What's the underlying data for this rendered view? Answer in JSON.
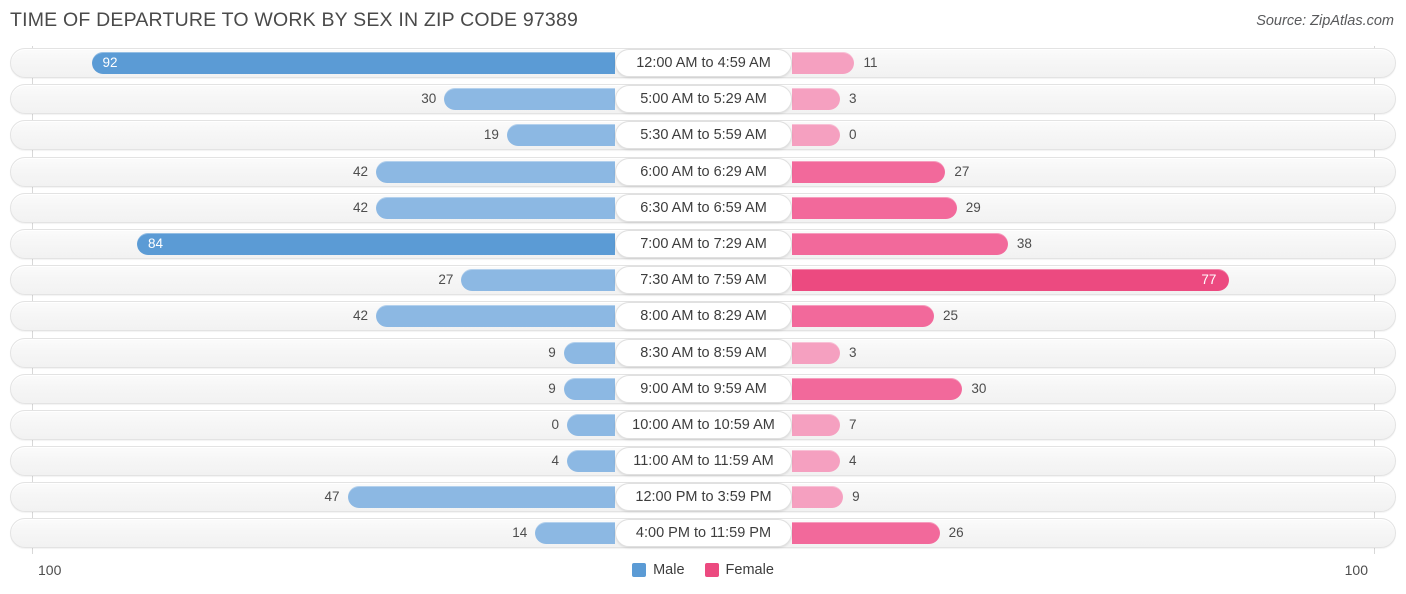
{
  "header": {
    "title": "TIME OF DEPARTURE TO WORK BY SEX IN ZIP CODE 97389",
    "source": "Source: ZipAtlas.com"
  },
  "legend": {
    "items": [
      {
        "label": "Male",
        "color": "#5b9bd5"
      },
      {
        "label": "Female",
        "color": "#ec4a80"
      }
    ]
  },
  "axis": {
    "left_max_label": "100",
    "right_max_label": "100"
  },
  "colors": {
    "male_strong": "#5b9bd5",
    "male_light": "#8cb8e3",
    "female_strong": "#ec4a80",
    "female_mid": "#f2699b",
    "female_light": "#f5a0c0",
    "track": "#f4f4f4",
    "axis_line": "#d8d8d8"
  },
  "chart_data": {
    "type": "bar",
    "title": "TIME OF DEPARTURE TO WORK BY SEX IN ZIP CODE 97389",
    "orientation": "horizontal-diverging",
    "xlabel": "",
    "ylabel": "",
    "xlim": [
      0,
      100
    ],
    "grid": false,
    "legend_position": "bottom-center",
    "categories": [
      "12:00 AM to 4:59 AM",
      "5:00 AM to 5:29 AM",
      "5:30 AM to 5:59 AM",
      "6:00 AM to 6:29 AM",
      "6:30 AM to 6:59 AM",
      "7:00 AM to 7:29 AM",
      "7:30 AM to 7:59 AM",
      "8:00 AM to 8:29 AM",
      "8:30 AM to 8:59 AM",
      "9:00 AM to 9:59 AM",
      "10:00 AM to 10:59 AM",
      "11:00 AM to 11:59 AM",
      "12:00 PM to 3:59 PM",
      "4:00 PM to 11:59 PM"
    ],
    "series": [
      {
        "name": "Male",
        "values": [
          92,
          30,
          19,
          42,
          42,
          84,
          27,
          42,
          9,
          9,
          0,
          4,
          47,
          14
        ]
      },
      {
        "name": "Female",
        "values": [
          11,
          3,
          0,
          27,
          29,
          38,
          77,
          25,
          3,
          30,
          7,
          4,
          9,
          26
        ]
      }
    ]
  },
  "rows": [
    {
      "category": "12:00 AM to 4:59 AM",
      "male": "92",
      "female": "11"
    },
    {
      "category": "5:00 AM to 5:29 AM",
      "male": "30",
      "female": "3"
    },
    {
      "category": "5:30 AM to 5:59 AM",
      "male": "19",
      "female": "0"
    },
    {
      "category": "6:00 AM to 6:29 AM",
      "male": "42",
      "female": "27"
    },
    {
      "category": "6:30 AM to 6:59 AM",
      "male": "42",
      "female": "29"
    },
    {
      "category": "7:00 AM to 7:29 AM",
      "male": "84",
      "female": "38"
    },
    {
      "category": "7:30 AM to 7:59 AM",
      "male": "27",
      "female": "77"
    },
    {
      "category": "8:00 AM to 8:29 AM",
      "male": "42",
      "female": "25"
    },
    {
      "category": "8:30 AM to 8:59 AM",
      "male": "9",
      "female": "3"
    },
    {
      "category": "9:00 AM to 9:59 AM",
      "male": "9",
      "female": "30"
    },
    {
      "category": "10:00 AM to 10:59 AM",
      "male": "0",
      "female": "7"
    },
    {
      "category": "11:00 AM to 11:59 AM",
      "male": "4",
      "female": "4"
    },
    {
      "category": "12:00 PM to 3:59 PM",
      "male": "47",
      "female": "9"
    },
    {
      "category": "4:00 PM to 11:59 PM",
      "male": "14",
      "female": "26"
    }
  ]
}
